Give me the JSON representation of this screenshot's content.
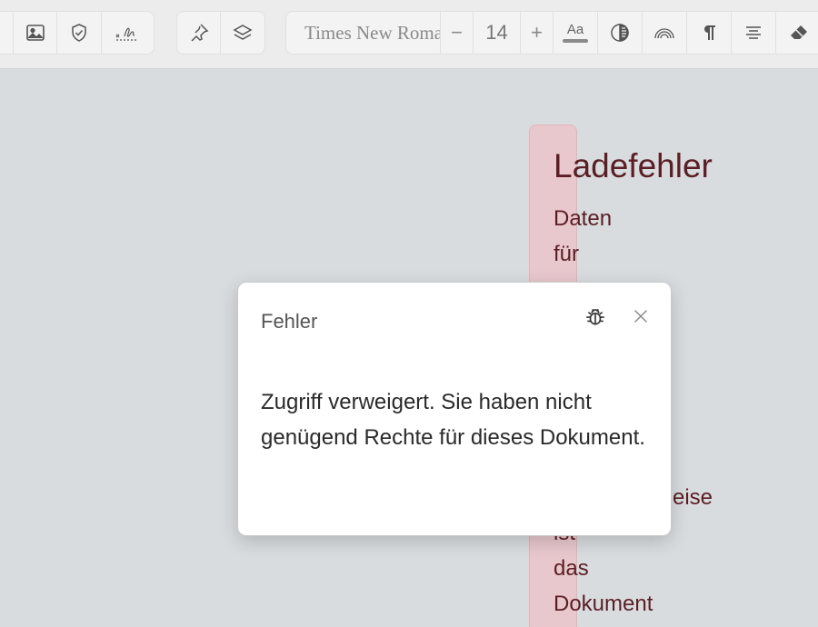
{
  "toolbar": {
    "font_name": "Times New Roman",
    "font_size": "14",
    "decrease_label": "−",
    "increase_label": "+",
    "text_style_label": "Aa",
    "icons": [
      "image-icon",
      "shield-icon",
      "signature-icon",
      "pin-icon",
      "layers-icon",
      "contrast-icon",
      "rainbow-icon",
      "pilcrow-icon",
      "align-center-icon",
      "eraser-icon"
    ]
  },
  "document": {
    "title": "Ladefehler",
    "words": [
      "Daten",
      "für",
      "eise",
      "ist",
      "das",
      "Dokument"
    ],
    "column_color": "#e8c8cd",
    "text_color": "#5a1e24"
  },
  "dialog": {
    "title": "Fehler",
    "message": "Zugriff verweigert. Sie haben nicht genügend Rechte für dieses Dokument.",
    "icons": [
      "bug-icon",
      "close-icon"
    ]
  }
}
